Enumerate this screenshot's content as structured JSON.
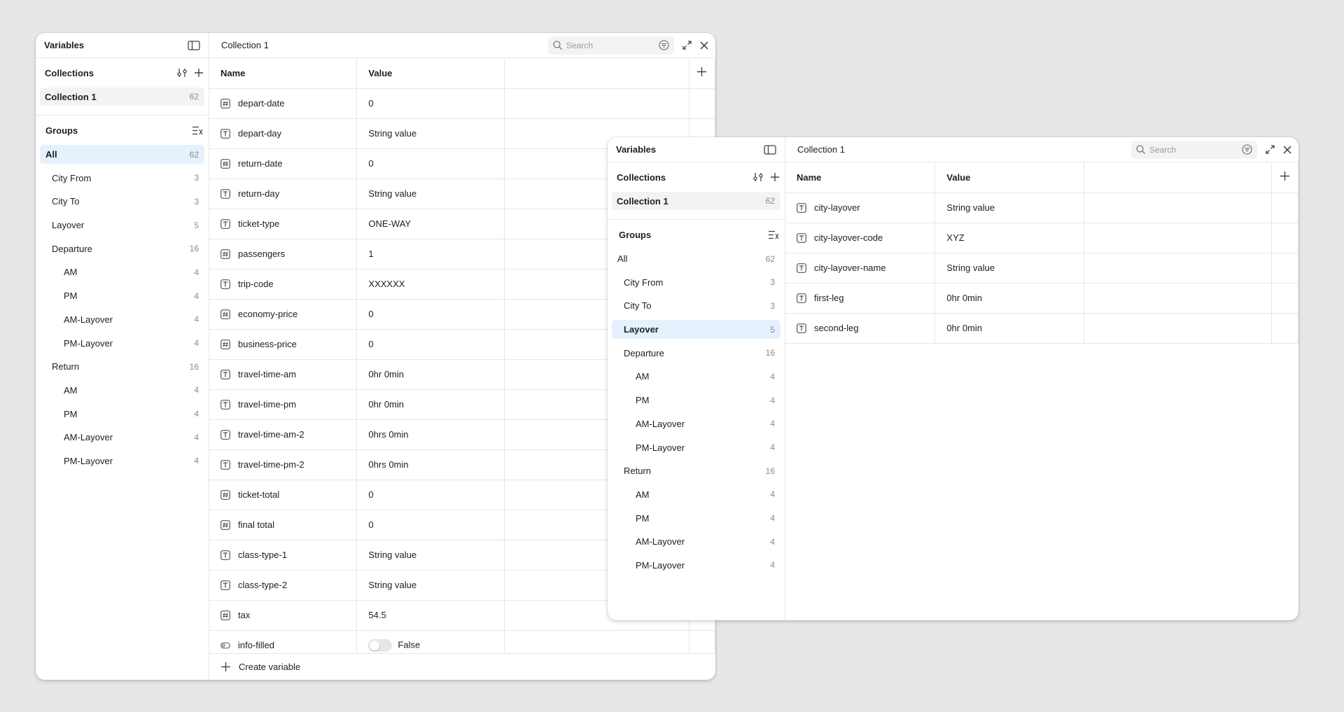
{
  "panel1": {
    "sidebar": {
      "title": "Variables",
      "collections_label": "Collections",
      "collection": {
        "name": "Collection 1",
        "count": "62"
      },
      "groups_label": "Groups",
      "groups": [
        {
          "label": "All",
          "count": "62",
          "level": 0,
          "active": true
        },
        {
          "label": "City From",
          "count": "3",
          "level": 1
        },
        {
          "label": "City To",
          "count": "3",
          "level": 1
        },
        {
          "label": "Layover",
          "count": "5",
          "level": 1
        },
        {
          "label": "Departure",
          "count": "16",
          "level": 1
        },
        {
          "label": "AM",
          "count": "4",
          "level": 2
        },
        {
          "label": "PM",
          "count": "4",
          "level": 2
        },
        {
          "label": "AM-Layover",
          "count": "4",
          "level": 2
        },
        {
          "label": "PM-Layover",
          "count": "4",
          "level": 2
        },
        {
          "label": "Return",
          "count": "16",
          "level": 1
        },
        {
          "label": "AM",
          "count": "4",
          "level": 2
        },
        {
          "label": "PM",
          "count": "4",
          "level": 2
        },
        {
          "label": "AM-Layover",
          "count": "4",
          "level": 2
        },
        {
          "label": "PM-Layover",
          "count": "4",
          "level": 2
        }
      ]
    },
    "main": {
      "collection_name": "Collection 1",
      "search_placeholder": "Search",
      "headers": {
        "name": "Name",
        "value": "Value"
      },
      "rows": [
        {
          "name": "depart-date",
          "value": "0",
          "type": "number"
        },
        {
          "name": "depart-day",
          "value": "String value",
          "type": "string"
        },
        {
          "name": "return-date",
          "value": "0",
          "type": "number"
        },
        {
          "name": "return-day",
          "value": "String value",
          "type": "string"
        },
        {
          "name": "ticket-type",
          "value": "ONE-WAY",
          "type": "string"
        },
        {
          "name": "passengers",
          "value": "1",
          "type": "number"
        },
        {
          "name": "trip-code",
          "value": "XXXXXX",
          "type": "string"
        },
        {
          "name": "economy-price",
          "value": "0",
          "type": "number"
        },
        {
          "name": "business-price",
          "value": "0",
          "type": "number"
        },
        {
          "name": "travel-time-am",
          "value": "0hr 0min",
          "type": "string"
        },
        {
          "name": "travel-time-pm",
          "value": "0hr 0min",
          "type": "string"
        },
        {
          "name": "travel-time-am-2",
          "value": "0hrs 0min",
          "type": "string"
        },
        {
          "name": "travel-time-pm-2",
          "value": "0hrs 0min",
          "type": "string"
        },
        {
          "name": "ticket-total",
          "value": "0",
          "type": "number"
        },
        {
          "name": "final total",
          "value": "0",
          "type": "number"
        },
        {
          "name": "class-type-1",
          "value": "String value",
          "type": "string"
        },
        {
          "name": "class-type-2",
          "value": "String value",
          "type": "string"
        },
        {
          "name": "tax",
          "value": "54.5",
          "type": "number"
        },
        {
          "name": "info-filled",
          "value": "False",
          "type": "boolean"
        }
      ],
      "create_label": "Create variable"
    }
  },
  "panel2": {
    "sidebar": {
      "title": "Variables",
      "collections_label": "Collections",
      "collection": {
        "name": "Collection 1",
        "count": "62"
      },
      "groups_label": "Groups",
      "groups": [
        {
          "label": "All",
          "count": "62",
          "level": 0
        },
        {
          "label": "City From",
          "count": "3",
          "level": 1
        },
        {
          "label": "City To",
          "count": "3",
          "level": 1
        },
        {
          "label": "Layover",
          "count": "5",
          "level": 1,
          "active": true
        },
        {
          "label": "Departure",
          "count": "16",
          "level": 1
        },
        {
          "label": "AM",
          "count": "4",
          "level": 2
        },
        {
          "label": "PM",
          "count": "4",
          "level": 2
        },
        {
          "label": "AM-Layover",
          "count": "4",
          "level": 2
        },
        {
          "label": "PM-Layover",
          "count": "4",
          "level": 2
        },
        {
          "label": "Return",
          "count": "16",
          "level": 1
        },
        {
          "label": "AM",
          "count": "4",
          "level": 2
        },
        {
          "label": "PM",
          "count": "4",
          "level": 2
        },
        {
          "label": "AM-Layover",
          "count": "4",
          "level": 2
        },
        {
          "label": "PM-Layover",
          "count": "4",
          "level": 2
        }
      ]
    },
    "main": {
      "collection_name": "Collection 1",
      "search_placeholder": "Search",
      "headers": {
        "name": "Name",
        "value": "Value"
      },
      "rows": [
        {
          "name": "city-layover",
          "value": "String value",
          "type": "string"
        },
        {
          "name": "city-layover-code",
          "value": "XYZ",
          "type": "string"
        },
        {
          "name": "city-layover-name",
          "value": "String value",
          "type": "string"
        },
        {
          "name": "first-leg",
          "value": "0hr 0min",
          "type": "string"
        },
        {
          "name": "second-leg",
          "value": "0hr 0min",
          "type": "string"
        }
      ]
    }
  },
  "colors": {
    "active_group": "#e5f1fc",
    "selected_collection": "#f3f3f3",
    "background": "#e8e7e7"
  },
  "icons": {
    "sidebar_toggle": "sidebar-toggle-icon",
    "adjust": "adjust-icon",
    "plus": "plus-icon",
    "group_sort": "group-sort-icon",
    "search": "search-icon",
    "filter": "filter-icon",
    "expand": "expand-icon",
    "close": "close-icon",
    "number_type": "number-type-icon",
    "string_type": "string-type-icon",
    "boolean_type": "boolean-type-icon"
  }
}
